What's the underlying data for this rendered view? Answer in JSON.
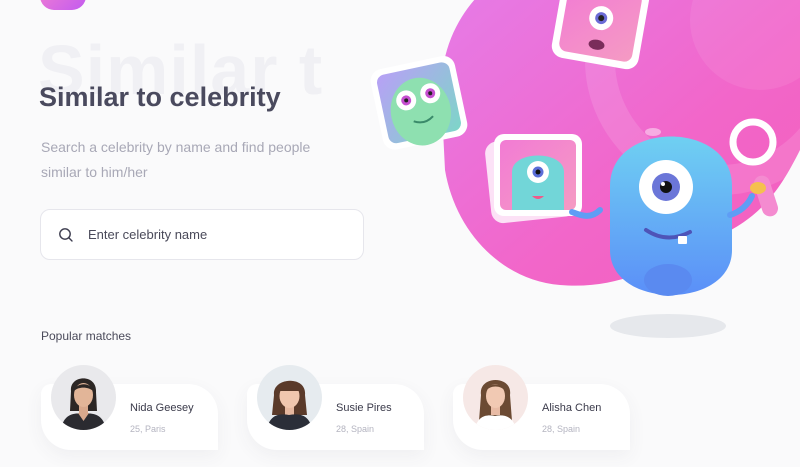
{
  "brand": {
    "accent": "#ef6fd0",
    "accent_dark": "#c35bf0",
    "monster_blue": "#5fa7f6"
  },
  "hero": {
    "background_word": "Similar t",
    "title": "Similar to celebrity",
    "subtitle": "Search a celebrity by name and find people similar to him/her"
  },
  "search": {
    "placeholder": "Enter celebrity name",
    "value": "",
    "icon": "search-icon"
  },
  "popular": {
    "heading": "Popular matches",
    "items": [
      {
        "name": "Nida Geesey",
        "meta": "25, Paris",
        "avatar_bg": "#e9e9ec"
      },
      {
        "name": "Susie Pires",
        "meta": "28, Spain",
        "avatar_bg": "#e6ebef"
      },
      {
        "name": "Alisha Chen",
        "meta": "28, Spain",
        "avatar_bg": "#f6e8e6"
      }
    ]
  }
}
